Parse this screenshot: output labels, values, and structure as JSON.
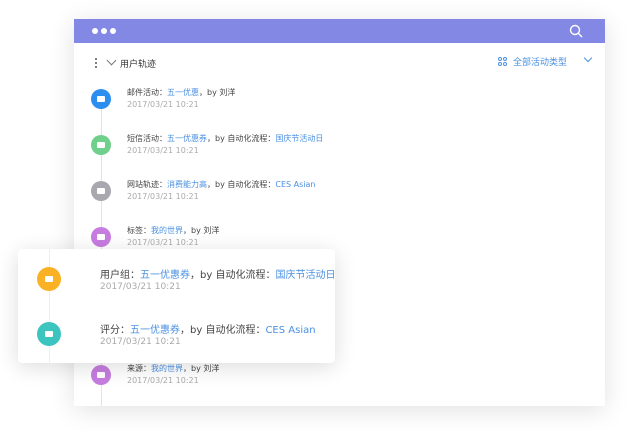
{
  "header": {
    "menu_icon": "more-dots-icon",
    "search_icon": "search-icon",
    "color": "#8288e3"
  },
  "toolbar": {
    "title": "用户轨迹",
    "filter": "全部活动类型"
  },
  "timeline": [
    {
      "label": "邮件活动：",
      "link1": "五一优惠",
      "mid": "，by 刘洋",
      "link2": "",
      "time": "2017/03/21 10:21",
      "color": "#2d8ef0",
      "icon": "mail-icon"
    },
    {
      "label": "短信活动：",
      "link1": "五一优惠券",
      "mid": "，by 自动化流程：",
      "link2": "国庆节活动日",
      "time": "2017/03/21 10:21",
      "color": "#6fd08c",
      "icon": "message-icon"
    },
    {
      "label": "网站轨迹：",
      "link1": "消费能力高",
      "mid": "，by 自动化流程：",
      "link2": "CES Asian",
      "time": "2017/03/21 10:21",
      "color": "#a8a8ae",
      "icon": "monitor-icon"
    },
    {
      "label": "标签：",
      "link1": "我的世界",
      "mid": "，by 刘洋",
      "link2": "",
      "time": "2017/03/21 10:21",
      "color": "#c77de0",
      "icon": "tag-icon"
    },
    {
      "label": "来源：",
      "link1": "我的世界",
      "mid": "，by 刘洋",
      "link2": "",
      "time": "2017/03/21 10:21",
      "color": "#c77de0",
      "icon": "compass-icon"
    }
  ],
  "popup": [
    {
      "label": "用户组：",
      "link1": "五一优惠券",
      "mid": "，by 自动化流程：",
      "link2": "国庆节活动日",
      "time": "2017/03/21 10:21",
      "color": "#fbb124",
      "icon": "user-group-icon"
    },
    {
      "label": "评分：",
      "link1": "五一优惠券",
      "mid": "，by 自动化流程：",
      "link2": "CES Asian",
      "time": "2017/03/21 10:21",
      "color": "#3cc4be",
      "icon": "rating-icon"
    }
  ]
}
